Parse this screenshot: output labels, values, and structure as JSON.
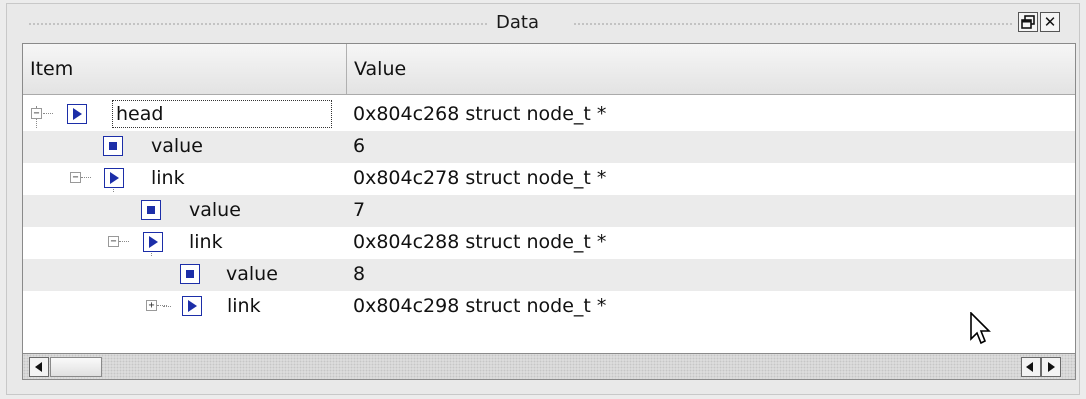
{
  "window": {
    "title": "Data",
    "float_button_glyph": "!",
    "close_button_glyph": "✕"
  },
  "columns": {
    "item": "Item",
    "value": "Value"
  },
  "rows": [
    {
      "label": "head",
      "value": "0x804c268 struct node_t *",
      "icon": "pointer-icon",
      "expander": "−"
    },
    {
      "label": "value",
      "value": "6",
      "icon": "scalar-icon"
    },
    {
      "label": "link",
      "value": "0x804c278 struct node_t *",
      "icon": "pointer-icon",
      "expander": "−"
    },
    {
      "label": "value",
      "value": "7",
      "icon": "scalar-icon"
    },
    {
      "label": "link",
      "value": "0x804c288 struct node_t *",
      "icon": "pointer-icon",
      "expander": "−"
    },
    {
      "label": "value",
      "value": "8",
      "icon": "scalar-icon"
    },
    {
      "label": "link",
      "value": "0x804c298 struct node_t *",
      "icon": "pointer-icon",
      "expander": "+"
    }
  ],
  "colors": {
    "icon_blue": "#1c2ea8",
    "alt_row": "#ebebeb"
  }
}
